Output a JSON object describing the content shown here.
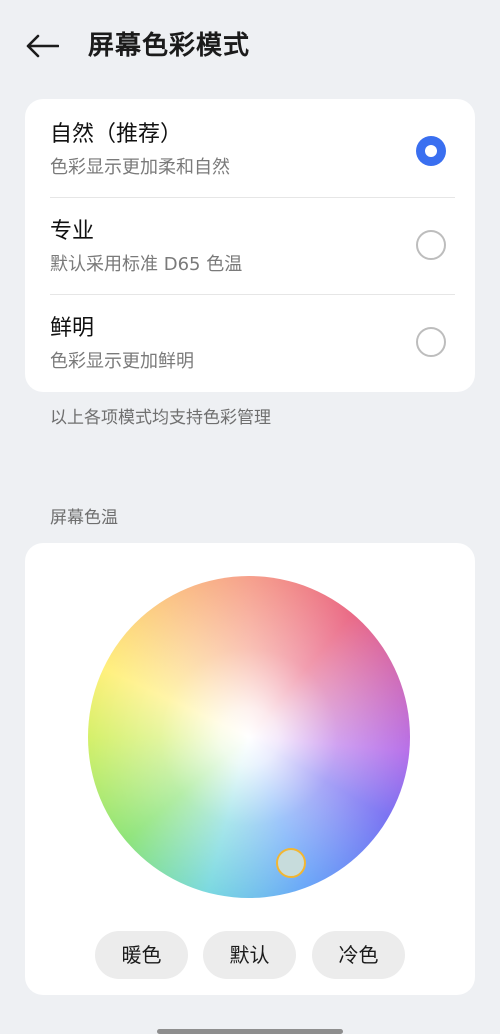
{
  "header": {
    "title": "屏幕色彩模式",
    "back_icon": "arrow-left-icon"
  },
  "modes": [
    {
      "title": "自然（推荐）",
      "description": "色彩显示更加柔和自然",
      "selected": true
    },
    {
      "title": "专业",
      "description": "默认采用标准 D65 色温",
      "selected": false
    },
    {
      "title": "鲜明",
      "description": "色彩显示更加鲜明",
      "selected": false
    }
  ],
  "note": "以上各项模式均支持色彩管理",
  "color_temperature": {
    "label": "屏幕色温",
    "buttons": {
      "warm": "暖色",
      "default": "默认",
      "cool": "冷色"
    }
  },
  "colors": {
    "accent": "#3a6ff0",
    "background": "#eef0f3",
    "card": "#ffffff",
    "handle_border": "#f2b632"
  }
}
